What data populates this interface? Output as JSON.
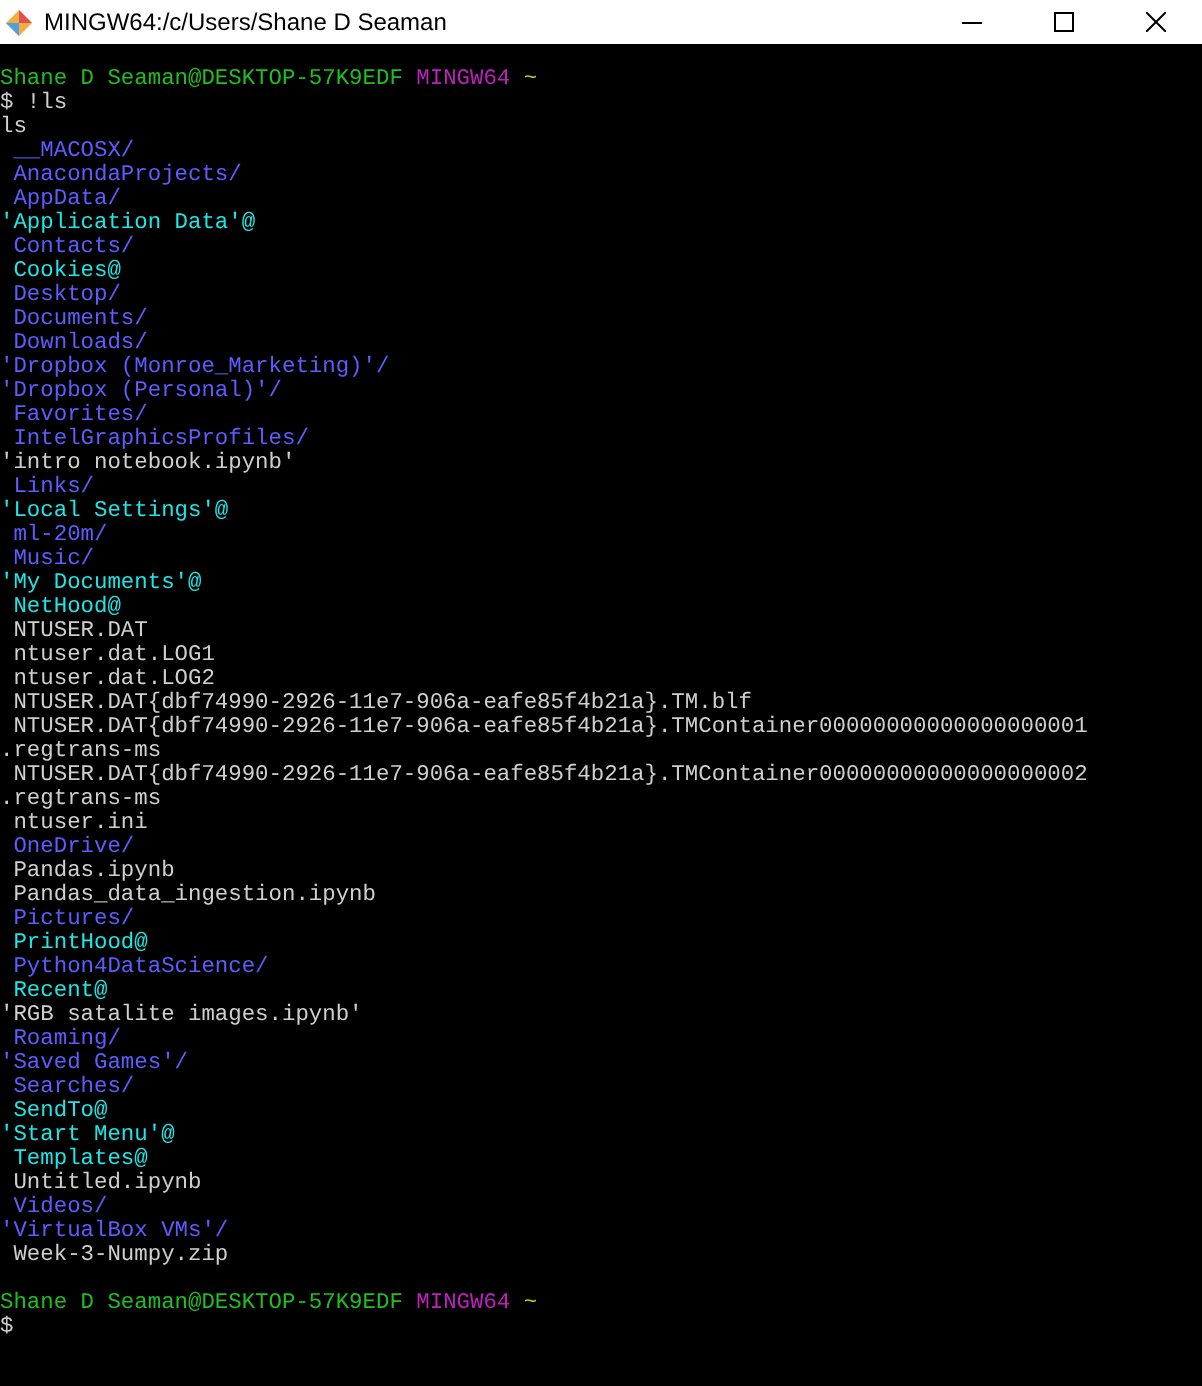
{
  "window": {
    "title": "MINGW64:/c/Users/Shane D Seaman"
  },
  "terminal": {
    "lines": [
      {
        "kind": "blank"
      },
      {
        "kind": "prompt",
        "user_host": "Shane D Seaman@DESKTOP-57K9EDF",
        "shell": "MINGW64",
        "path": "~"
      },
      {
        "kind": "file",
        "text": "$ !ls"
      },
      {
        "kind": "file",
        "text": "ls"
      },
      {
        "kind": "dir",
        "text": " __MACOSX/"
      },
      {
        "kind": "dir",
        "text": " AnacondaProjects/"
      },
      {
        "kind": "dir",
        "text": " AppData/"
      },
      {
        "kind": "link",
        "text": "'Application Data'@"
      },
      {
        "kind": "dir",
        "text": " Contacts/"
      },
      {
        "kind": "link",
        "text": " Cookies@"
      },
      {
        "kind": "dir",
        "text": " Desktop/"
      },
      {
        "kind": "dir",
        "text": " Documents/"
      },
      {
        "kind": "dir",
        "text": " Downloads/"
      },
      {
        "kind": "dir",
        "text": "'Dropbox (Monroe_Marketing)'/"
      },
      {
        "kind": "dir",
        "text": "'Dropbox (Personal)'/"
      },
      {
        "kind": "dir",
        "text": " Favorites/"
      },
      {
        "kind": "dir",
        "text": " IntelGraphicsProfiles/"
      },
      {
        "kind": "file",
        "text": "'intro notebook.ipynb'"
      },
      {
        "kind": "dir",
        "text": " Links/"
      },
      {
        "kind": "link",
        "text": "'Local Settings'@"
      },
      {
        "kind": "dir",
        "text": " ml-20m/"
      },
      {
        "kind": "dir",
        "text": " Music/"
      },
      {
        "kind": "link",
        "text": "'My Documents'@"
      },
      {
        "kind": "link",
        "text": " NetHood@"
      },
      {
        "kind": "file",
        "text": " NTUSER.DAT"
      },
      {
        "kind": "file",
        "text": " ntuser.dat.LOG1"
      },
      {
        "kind": "file",
        "text": " ntuser.dat.LOG2"
      },
      {
        "kind": "file",
        "text": " NTUSER.DAT{dbf74990-2926-11e7-906a-eafe85f4b21a}.TM.blf"
      },
      {
        "kind": "file",
        "text": " NTUSER.DAT{dbf74990-2926-11e7-906a-eafe85f4b21a}.TMContainer00000000000000000001"
      },
      {
        "kind": "file",
        "text": ".regtrans-ms"
      },
      {
        "kind": "file",
        "text": " NTUSER.DAT{dbf74990-2926-11e7-906a-eafe85f4b21a}.TMContainer00000000000000000002"
      },
      {
        "kind": "file",
        "text": ".regtrans-ms"
      },
      {
        "kind": "file",
        "text": " ntuser.ini"
      },
      {
        "kind": "dir",
        "text": " OneDrive/"
      },
      {
        "kind": "file",
        "text": " Pandas.ipynb"
      },
      {
        "kind": "file",
        "text": " Pandas_data_ingestion.ipynb"
      },
      {
        "kind": "dir",
        "text": " Pictures/"
      },
      {
        "kind": "link",
        "text": " PrintHood@"
      },
      {
        "kind": "dir",
        "text": " Python4DataScience/"
      },
      {
        "kind": "link",
        "text": " Recent@"
      },
      {
        "kind": "file",
        "text": "'RGB satalite images.ipynb'"
      },
      {
        "kind": "dir",
        "text": " Roaming/"
      },
      {
        "kind": "dir",
        "text": "'Saved Games'/"
      },
      {
        "kind": "dir",
        "text": " Searches/"
      },
      {
        "kind": "link",
        "text": " SendTo@"
      },
      {
        "kind": "link",
        "text": "'Start Menu'@"
      },
      {
        "kind": "link",
        "text": " Templates@"
      },
      {
        "kind": "file",
        "text": " Untitled.ipynb"
      },
      {
        "kind": "dir",
        "text": " Videos/"
      },
      {
        "kind": "dir",
        "text": "'VirtualBox VMs'/"
      },
      {
        "kind": "file",
        "text": " Week-3-Numpy.zip"
      },
      {
        "kind": "blank"
      },
      {
        "kind": "prompt",
        "user_host": "Shane D Seaman@DESKTOP-57K9EDF",
        "shell": "MINGW64",
        "path": "~"
      },
      {
        "kind": "file",
        "text": "$"
      }
    ]
  }
}
